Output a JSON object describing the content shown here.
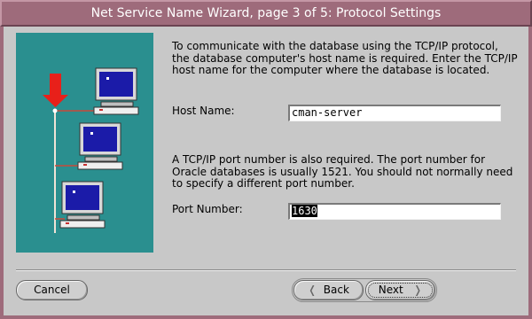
{
  "window": {
    "title": "Net Service Name Wizard, page 3 of 5: Protocol Settings"
  },
  "content": {
    "paragraph1": "To communicate with the database using the TCP/IP protocol, the database computer's host name is required. Enter the TCP/IP host name for the computer where the database is located.",
    "host_label": "Host Name:",
    "host_value": "cman-server",
    "paragraph2": "A TCP/IP port number is also required.  The port number for Oracle databases is usually 1521.  You should not normally need to specify a different port number.",
    "port_label": "Port Number:",
    "port_value": "1630"
  },
  "buttons": {
    "cancel": "Cancel",
    "back": "Back",
    "next": "Next"
  },
  "icons": {
    "back": "chevron-left-icon",
    "next": "chevron-right-icon",
    "arrow": "red-down-arrow",
    "computer": "computer-icon"
  },
  "colors": {
    "titlebar": "#9e6b7b",
    "illustration_bg": "#2a8f8f",
    "window_bg": "#c8c8c8",
    "arrow": "#e8201a",
    "network_line": "#e8d8c8"
  }
}
